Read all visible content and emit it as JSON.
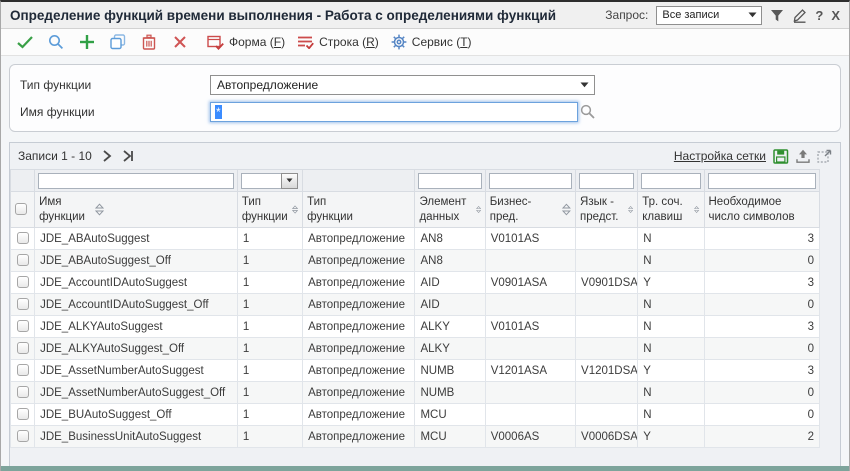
{
  "window": {
    "title": "Определение функций времени выполнения - Работа с определениями функций",
    "query_label": "Запрос:",
    "query_value": "Все записи",
    "help_glyph": "?",
    "close_glyph": "X"
  },
  "toolbar": {
    "menus": [
      {
        "pre": "Форма (",
        "key": "F",
        "post": ")"
      },
      {
        "pre": "Строка (",
        "key": "R",
        "post": ")"
      },
      {
        "pre": "Сервис (",
        "key": "T",
        "post": ")"
      }
    ]
  },
  "form": {
    "type_label": "Тип функции",
    "type_value": "Автопредложение",
    "name_label": "Имя функции",
    "name_value": "*"
  },
  "grid": {
    "records_label": "Записи 1 - 10",
    "settings_link": "Настройка сетки",
    "columns": [
      {
        "label": "Имя функции",
        "sortable": true
      },
      {
        "label": "Тип функции",
        "sortable": true
      },
      {
        "label": "Тип функции",
        "sortable": false
      },
      {
        "label": "Элемент данных",
        "sortable": true
      },
      {
        "label": "Бизнес-пред.",
        "sortable": true
      },
      {
        "label": "Язык - предст.",
        "sortable": true
      },
      {
        "label": "Тр. соч. клавиш",
        "sortable": true
      },
      {
        "label": "Необходимое число символов",
        "sortable": false
      }
    ],
    "rows": [
      {
        "name": "JDE_ABAutoSuggest",
        "type_code": "1",
        "type_name": "Автопредложение",
        "data_item": "AN8",
        "bp_view": "V0101AS",
        "lang_view": "",
        "hotkey": "N",
        "chars": "3"
      },
      {
        "name": "JDE_ABAutoSuggest_Off",
        "type_code": "1",
        "type_name": "Автопредложение",
        "data_item": "AN8",
        "bp_view": "",
        "lang_view": "",
        "hotkey": "N",
        "chars": "0"
      },
      {
        "name": "JDE_AccountIDAutoSuggest",
        "type_code": "1",
        "type_name": "Автопредложение",
        "data_item": "AID",
        "bp_view": "V0901ASA",
        "lang_view": "V0901DSA",
        "hotkey": "Y",
        "chars": "3"
      },
      {
        "name": "JDE_AccountIDAutoSuggest_Off",
        "type_code": "1",
        "type_name": "Автопредложение",
        "data_item": "AID",
        "bp_view": "",
        "lang_view": "",
        "hotkey": "N",
        "chars": "0"
      },
      {
        "name": "JDE_ALKYAutoSuggest",
        "type_code": "1",
        "type_name": "Автопредложение",
        "data_item": "ALKY",
        "bp_view": "V0101AS",
        "lang_view": "",
        "hotkey": "N",
        "chars": "3"
      },
      {
        "name": "JDE_ALKYAutoSuggest_Off",
        "type_code": "1",
        "type_name": "Автопредложение",
        "data_item": "ALKY",
        "bp_view": "",
        "lang_view": "",
        "hotkey": "N",
        "chars": "0"
      },
      {
        "name": "JDE_AssetNumberAutoSuggest",
        "type_code": "1",
        "type_name": "Автопредложение",
        "data_item": "NUMB",
        "bp_view": "V1201ASA",
        "lang_view": "V1201DSA",
        "hotkey": "Y",
        "chars": "3"
      },
      {
        "name": "JDE_AssetNumberAutoSuggest_Off",
        "type_code": "1",
        "type_name": "Автопредложение",
        "data_item": "NUMB",
        "bp_view": "",
        "lang_view": "",
        "hotkey": "N",
        "chars": "0"
      },
      {
        "name": "JDE_BUAutoSuggest_Off",
        "type_code": "1",
        "type_name": "Автопредложение",
        "data_item": "MCU",
        "bp_view": "",
        "lang_view": "",
        "hotkey": "N",
        "chars": "0"
      },
      {
        "name": "JDE_BusinessUnitAutoSuggest",
        "type_code": "1",
        "type_name": "Автопредложение",
        "data_item": "MCU",
        "bp_view": "V0006AS",
        "lang_view": "V0006DSA",
        "hotkey": "Y",
        "chars": "2"
      }
    ]
  },
  "colors": {
    "accent_green": "#31a046",
    "accent_blue": "#5c9cd9",
    "accent_red": "#cc4b4b",
    "selection_blue": "#3b8cff",
    "footer_teal": "#7da49b"
  }
}
